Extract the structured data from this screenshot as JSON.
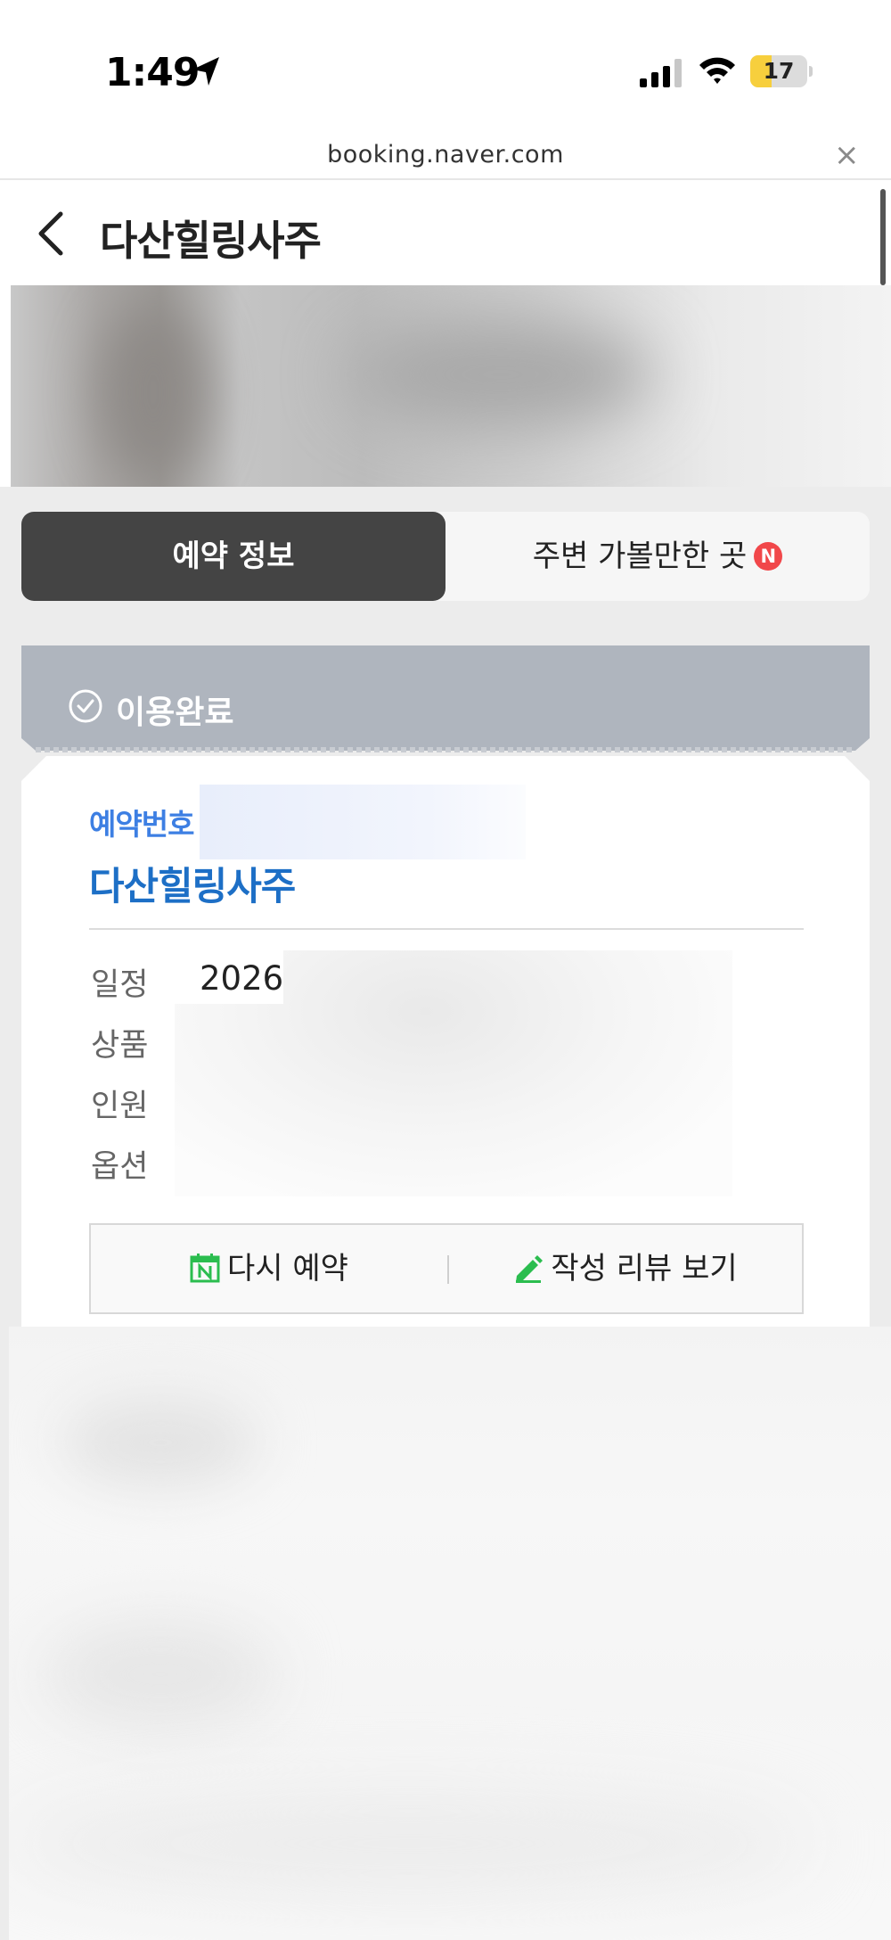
{
  "status_bar": {
    "time": "1:49",
    "battery_level": "17",
    "battery_fraction": 0.17,
    "icons": [
      "location-arrow-icon",
      "cellular-signal-icon",
      "wifi-icon",
      "battery-icon"
    ]
  },
  "browser": {
    "url": "booking.naver.com",
    "close_glyph": "×"
  },
  "header": {
    "title": "다산힐링사주"
  },
  "tabs": [
    {
      "label": "예약 정보",
      "active": true
    },
    {
      "label": "주변 가볼만한 곳",
      "badge": "N",
      "active": false
    }
  ],
  "booking": {
    "status": "이용완료",
    "reservation_label": "예약번호",
    "store_name": "다산힐링사주",
    "info": {
      "schedule_label": "일정",
      "schedule_value": "2026",
      "product_label": "상품",
      "people_label": "인원",
      "option_label": "옵션"
    },
    "actions": {
      "rebook": "다시 예약",
      "review": "작성 리뷰 보기"
    }
  },
  "colors": {
    "tab_active_bg": "#444444",
    "status_header_bg": "#afb5be",
    "reservation_label": "#3d7fe3",
    "store_name": "#1d6fc6",
    "badge_red": "#f1474a",
    "action_icon_green": "#2bbd4f",
    "battery_yellow": "#f7cf3d"
  }
}
